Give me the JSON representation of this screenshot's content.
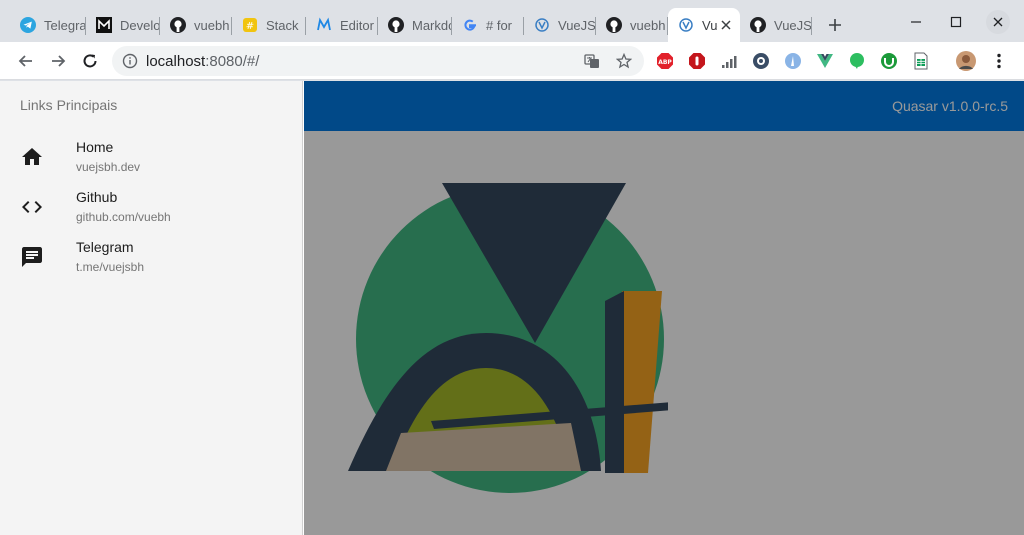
{
  "browser": {
    "tabs": [
      {
        "title": "Telegram",
        "icon": "telegram-icon",
        "active": false
      },
      {
        "title": "Developer",
        "icon": "medium-icon",
        "active": false
      },
      {
        "title": "vuebh",
        "icon": "github-icon",
        "active": false
      },
      {
        "title": "Stack",
        "icon": "stackedit-icon",
        "active": false
      },
      {
        "title": "Editor",
        "icon": "markdown-editor-icon",
        "active": false
      },
      {
        "title": "Markdown",
        "icon": "github-icon",
        "active": false
      },
      {
        "title": "# for",
        "icon": "google-icon",
        "active": false
      },
      {
        "title": "VueJS",
        "icon": "vuejs-icon",
        "active": false
      },
      {
        "title": "vuebh",
        "icon": "github-icon",
        "active": false
      },
      {
        "title": "VueJS",
        "icon": "vuejs-icon",
        "active": true
      },
      {
        "title": "VueJS",
        "icon": "github-icon",
        "active": false
      }
    ],
    "url_host": "localhost",
    "url_path": ":8080/#/",
    "extensions": [
      "adblock-plus-icon",
      "stop-icon",
      "signal-icon",
      "ghostery-icon",
      "cursor-icon",
      "vue-devtools-icon",
      "evernote-icon",
      "utorrent-icon",
      "sheets-icon"
    ]
  },
  "drawer": {
    "header": "Links Principais",
    "links": [
      {
        "title": "Home",
        "caption": "vuejsbh.dev",
        "icon": "home-icon"
      },
      {
        "title": "Github",
        "caption": "github.com/vuebh",
        "icon": "code-icon"
      },
      {
        "title": "Telegram",
        "caption": "t.me/vuejsbh",
        "icon": "chat-icon"
      }
    ]
  },
  "app": {
    "version": "Quasar v1.0.0-rc.5",
    "header_color": "#027be3",
    "logo": "vuejsbh-logo"
  }
}
